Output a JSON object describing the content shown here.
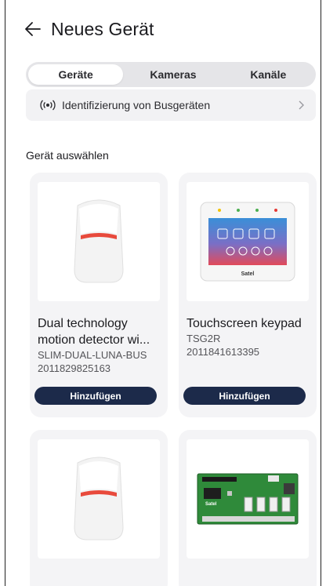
{
  "header": {
    "title": "Neues Gerät"
  },
  "tabs": [
    {
      "label": "Geräte",
      "active": true
    },
    {
      "label": "Kameras",
      "active": false
    },
    {
      "label": "Kanäle",
      "active": false
    }
  ],
  "bus_identification": {
    "label": "Identifizierung von Busgeräten",
    "icon": "broadcast-icon"
  },
  "section": {
    "title": "Gerät auswählen"
  },
  "devices": [
    {
      "name": "Dual technology motion detector wi...",
      "model": "SLIM-DUAL-LUNA-BUS",
      "serial": "2011829825163",
      "button": "Hinzufügen"
    },
    {
      "name": "Touchscreen keypad",
      "model": "TSG2R",
      "serial": "2011841613395",
      "button": "Hinzufügen",
      "brand": "Satel"
    },
    {
      "name": "",
      "model": "",
      "serial": ""
    },
    {
      "name": "",
      "model": "",
      "serial": "",
      "brand": "Satel"
    }
  ],
  "colors": {
    "button": "#1c2a4a",
    "tab_track": "#e5e5e8",
    "card": "#f4f4f6",
    "detector_lens": "#e84a3c"
  }
}
